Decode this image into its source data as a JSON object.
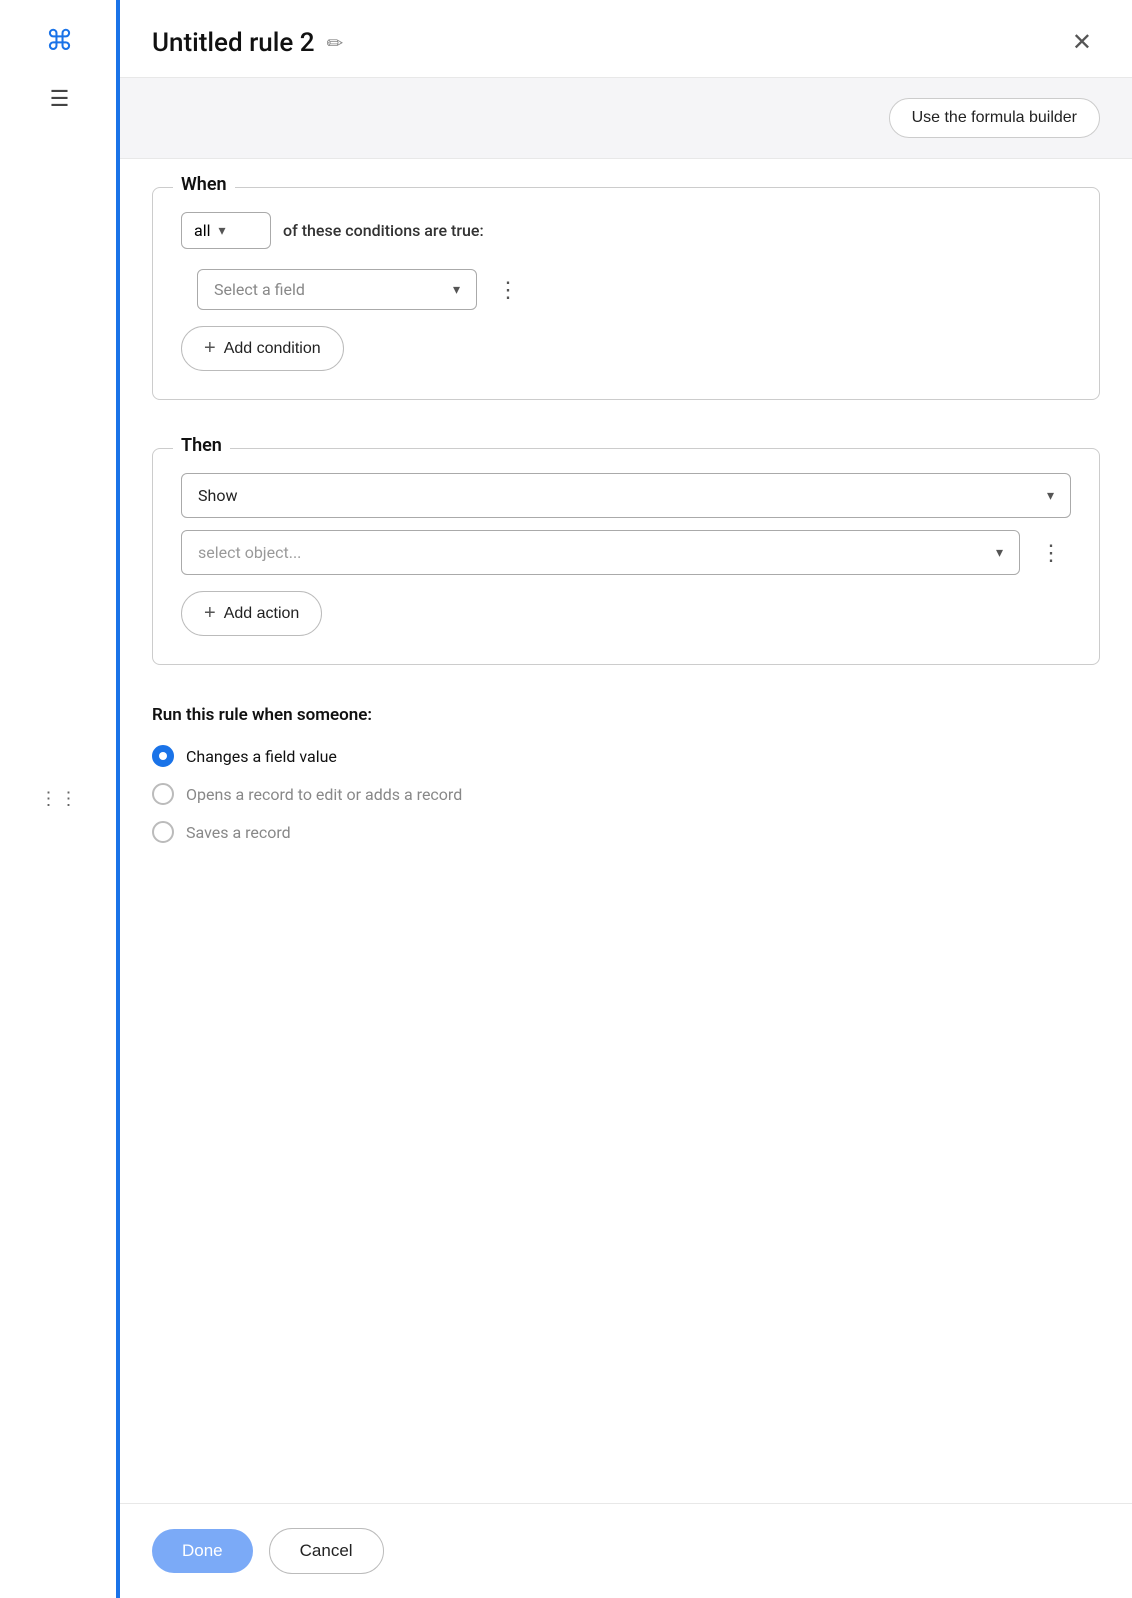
{
  "sidebar": {
    "main_icon": "⌘",
    "menu_icon": "☰",
    "dots": "⋮⋮"
  },
  "header": {
    "title": "Untitled rule 2",
    "edit_icon": "✏",
    "close_icon": "✕"
  },
  "formula_bar": {
    "button_label": "Use the formula builder"
  },
  "when_section": {
    "label": "When",
    "all_option": "all",
    "condition_text": "of these conditions are true:",
    "select_field_placeholder": "Select a field",
    "add_condition_label": "Add condition"
  },
  "then_section": {
    "label": "Then",
    "show_option": "Show",
    "select_object_placeholder": "select object...",
    "add_action_label": "Add action"
  },
  "run_section": {
    "title": "Run this rule when someone:",
    "options": [
      {
        "label": "Changes a field value",
        "selected": true
      },
      {
        "label": "Opens a record to edit or adds a record",
        "selected": false
      },
      {
        "label": "Saves a record",
        "selected": false
      }
    ]
  },
  "footer": {
    "done_label": "Done",
    "cancel_label": "Cancel"
  }
}
